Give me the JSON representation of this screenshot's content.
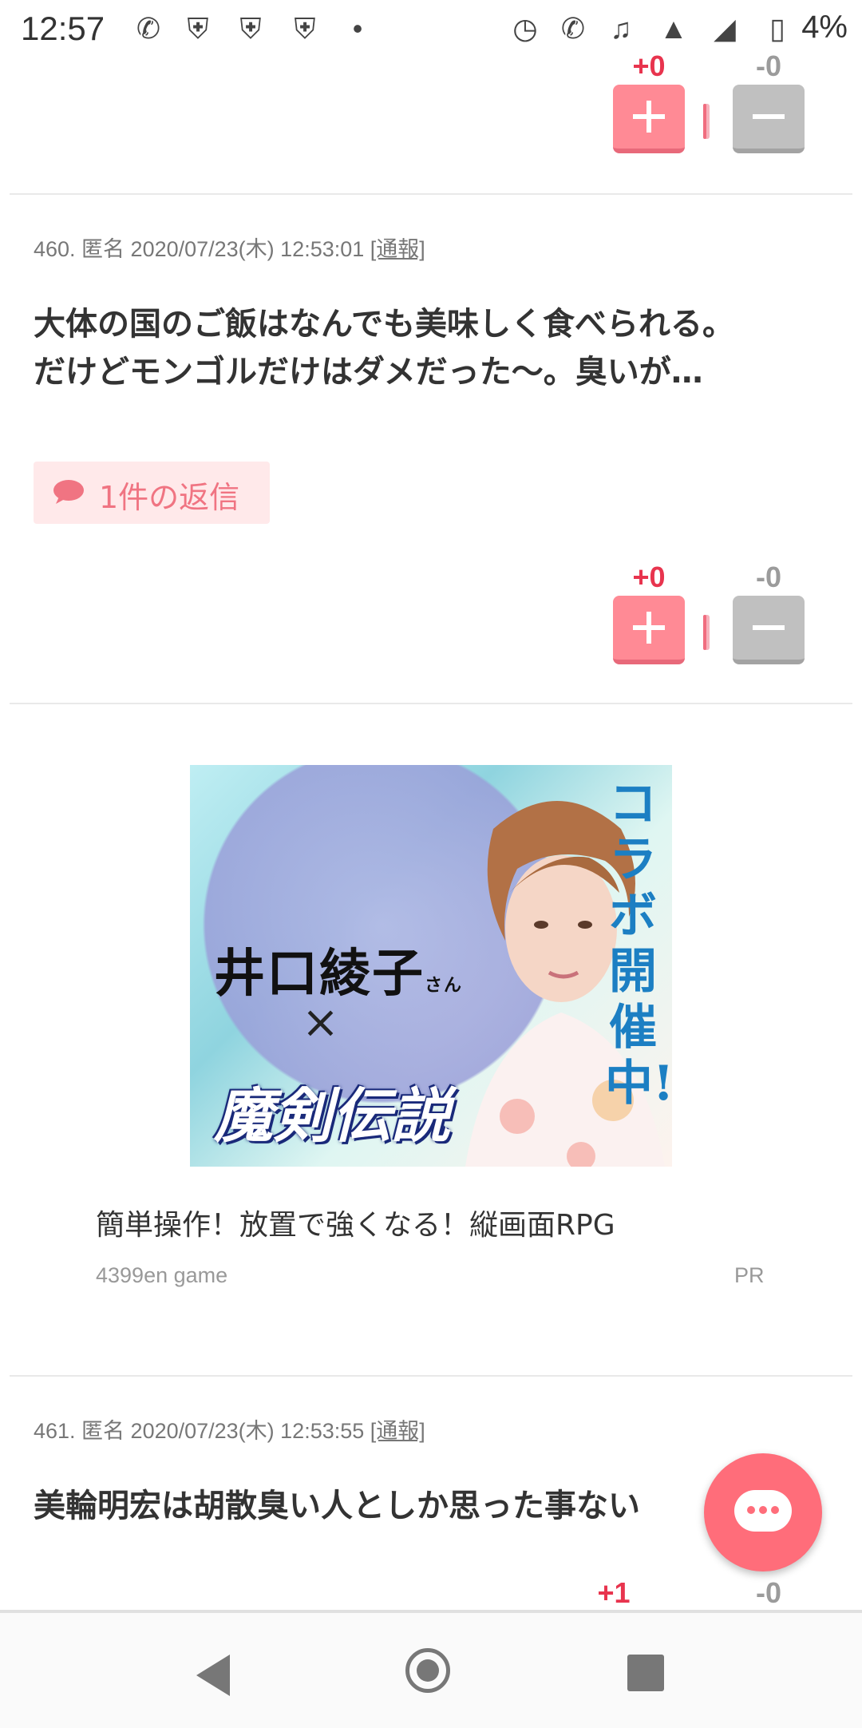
{
  "status_bar": {
    "time": "12:57",
    "battery": "4%",
    "icons": [
      "phone-wifi-icon",
      "shield-icon",
      "shield-icon",
      "shield-phone-icon",
      "dot-icon",
      "alarm-icon",
      "wifi-call-icon",
      "mute-icon",
      "wifi-icon",
      "signal-icon",
      "battery-icon"
    ]
  },
  "top_vote": {
    "plus": "+0",
    "minus": "-0"
  },
  "comment_460": {
    "meta": "460. 匿名 2020/07/23(木) 12:53:01 ",
    "report": "[通報]",
    "text_line1": "大体の国のご飯はなんでも美味しく食べられる。",
    "text_line2": "だけどモンゴルだけはダメだった〜。臭いが…",
    "reply_label": "1件の返信",
    "plus": "+0",
    "minus": "-0"
  },
  "ad": {
    "collab_text": "コラボ開催中!",
    "name_text": "井口綾子",
    "name_suffix": "さん",
    "cross": "×",
    "logo_text": "魔剣伝説",
    "title": "簡単操作！放置で強くなる！縦画面RPG",
    "source": "4399en game",
    "pr": "PR"
  },
  "comment_461": {
    "meta": "461. 匿名 2020/07/23(木) 12:53:55 ",
    "report": "[通報]",
    "text": "美輪明宏は胡散臭い人としか思った事ない",
    "plus": "+1",
    "minus": "-0"
  },
  "colors": {
    "accent": "#ff6d7a",
    "plus": "#e8344e",
    "minus_btn": "#c0c0c0"
  }
}
